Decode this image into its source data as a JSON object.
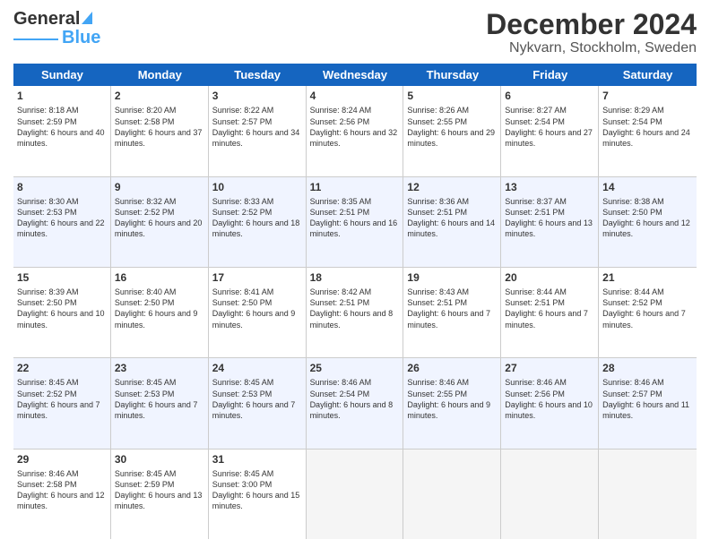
{
  "logo": {
    "text1": "General",
    "text2": "Blue"
  },
  "title": "December 2024",
  "location": "Nykvarn, Stockholm, Sweden",
  "days": [
    "Sunday",
    "Monday",
    "Tuesday",
    "Wednesday",
    "Thursday",
    "Friday",
    "Saturday"
  ],
  "weeks": [
    [
      {
        "day": "1",
        "sunrise": "Sunrise: 8:18 AM",
        "sunset": "Sunset: 2:59 PM",
        "daylight": "Daylight: 6 hours and 40 minutes."
      },
      {
        "day": "2",
        "sunrise": "Sunrise: 8:20 AM",
        "sunset": "Sunset: 2:58 PM",
        "daylight": "Daylight: 6 hours and 37 minutes."
      },
      {
        "day": "3",
        "sunrise": "Sunrise: 8:22 AM",
        "sunset": "Sunset: 2:57 PM",
        "daylight": "Daylight: 6 hours and 34 minutes."
      },
      {
        "day": "4",
        "sunrise": "Sunrise: 8:24 AM",
        "sunset": "Sunset: 2:56 PM",
        "daylight": "Daylight: 6 hours and 32 minutes."
      },
      {
        "day": "5",
        "sunrise": "Sunrise: 8:26 AM",
        "sunset": "Sunset: 2:55 PM",
        "daylight": "Daylight: 6 hours and 29 minutes."
      },
      {
        "day": "6",
        "sunrise": "Sunrise: 8:27 AM",
        "sunset": "Sunset: 2:54 PM",
        "daylight": "Daylight: 6 hours and 27 minutes."
      },
      {
        "day": "7",
        "sunrise": "Sunrise: 8:29 AM",
        "sunset": "Sunset: 2:54 PM",
        "daylight": "Daylight: 6 hours and 24 minutes."
      }
    ],
    [
      {
        "day": "8",
        "sunrise": "Sunrise: 8:30 AM",
        "sunset": "Sunset: 2:53 PM",
        "daylight": "Daylight: 6 hours and 22 minutes."
      },
      {
        "day": "9",
        "sunrise": "Sunrise: 8:32 AM",
        "sunset": "Sunset: 2:52 PM",
        "daylight": "Daylight: 6 hours and 20 minutes."
      },
      {
        "day": "10",
        "sunrise": "Sunrise: 8:33 AM",
        "sunset": "Sunset: 2:52 PM",
        "daylight": "Daylight: 6 hours and 18 minutes."
      },
      {
        "day": "11",
        "sunrise": "Sunrise: 8:35 AM",
        "sunset": "Sunset: 2:51 PM",
        "daylight": "Daylight: 6 hours and 16 minutes."
      },
      {
        "day": "12",
        "sunrise": "Sunrise: 8:36 AM",
        "sunset": "Sunset: 2:51 PM",
        "daylight": "Daylight: 6 hours and 14 minutes."
      },
      {
        "day": "13",
        "sunrise": "Sunrise: 8:37 AM",
        "sunset": "Sunset: 2:51 PM",
        "daylight": "Daylight: 6 hours and 13 minutes."
      },
      {
        "day": "14",
        "sunrise": "Sunrise: 8:38 AM",
        "sunset": "Sunset: 2:50 PM",
        "daylight": "Daylight: 6 hours and 12 minutes."
      }
    ],
    [
      {
        "day": "15",
        "sunrise": "Sunrise: 8:39 AM",
        "sunset": "Sunset: 2:50 PM",
        "daylight": "Daylight: 6 hours and 10 minutes."
      },
      {
        "day": "16",
        "sunrise": "Sunrise: 8:40 AM",
        "sunset": "Sunset: 2:50 PM",
        "daylight": "Daylight: 6 hours and 9 minutes."
      },
      {
        "day": "17",
        "sunrise": "Sunrise: 8:41 AM",
        "sunset": "Sunset: 2:50 PM",
        "daylight": "Daylight: 6 hours and 9 minutes."
      },
      {
        "day": "18",
        "sunrise": "Sunrise: 8:42 AM",
        "sunset": "Sunset: 2:51 PM",
        "daylight": "Daylight: 6 hours and 8 minutes."
      },
      {
        "day": "19",
        "sunrise": "Sunrise: 8:43 AM",
        "sunset": "Sunset: 2:51 PM",
        "daylight": "Daylight: 6 hours and 7 minutes."
      },
      {
        "day": "20",
        "sunrise": "Sunrise: 8:44 AM",
        "sunset": "Sunset: 2:51 PM",
        "daylight": "Daylight: 6 hours and 7 minutes."
      },
      {
        "day": "21",
        "sunrise": "Sunrise: 8:44 AM",
        "sunset": "Sunset: 2:52 PM",
        "daylight": "Daylight: 6 hours and 7 minutes."
      }
    ],
    [
      {
        "day": "22",
        "sunrise": "Sunrise: 8:45 AM",
        "sunset": "Sunset: 2:52 PM",
        "daylight": "Daylight: 6 hours and 7 minutes."
      },
      {
        "day": "23",
        "sunrise": "Sunrise: 8:45 AM",
        "sunset": "Sunset: 2:53 PM",
        "daylight": "Daylight: 6 hours and 7 minutes."
      },
      {
        "day": "24",
        "sunrise": "Sunrise: 8:45 AM",
        "sunset": "Sunset: 2:53 PM",
        "daylight": "Daylight: 6 hours and 7 minutes."
      },
      {
        "day": "25",
        "sunrise": "Sunrise: 8:46 AM",
        "sunset": "Sunset: 2:54 PM",
        "daylight": "Daylight: 6 hours and 8 minutes."
      },
      {
        "day": "26",
        "sunrise": "Sunrise: 8:46 AM",
        "sunset": "Sunset: 2:55 PM",
        "daylight": "Daylight: 6 hours and 9 minutes."
      },
      {
        "day": "27",
        "sunrise": "Sunrise: 8:46 AM",
        "sunset": "Sunset: 2:56 PM",
        "daylight": "Daylight: 6 hours and 10 minutes."
      },
      {
        "day": "28",
        "sunrise": "Sunrise: 8:46 AM",
        "sunset": "Sunset: 2:57 PM",
        "daylight": "Daylight: 6 hours and 11 minutes."
      }
    ],
    [
      {
        "day": "29",
        "sunrise": "Sunrise: 8:46 AM",
        "sunset": "Sunset: 2:58 PM",
        "daylight": "Daylight: 6 hours and 12 minutes."
      },
      {
        "day": "30",
        "sunrise": "Sunrise: 8:45 AM",
        "sunset": "Sunset: 2:59 PM",
        "daylight": "Daylight: 6 hours and 13 minutes."
      },
      {
        "day": "31",
        "sunrise": "Sunrise: 8:45 AM",
        "sunset": "Sunset: 3:00 PM",
        "daylight": "Daylight: 6 hours and 15 minutes."
      },
      null,
      null,
      null,
      null
    ]
  ]
}
